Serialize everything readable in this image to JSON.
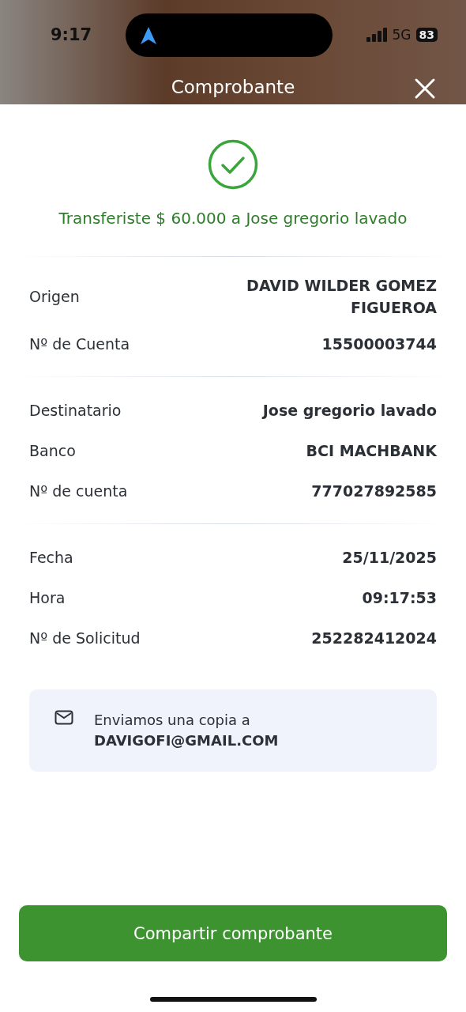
{
  "status_bar": {
    "time": "9:17",
    "network": "5G",
    "battery": "83"
  },
  "header": {
    "title": "Comprobante"
  },
  "result": {
    "message": "Transferiste $ 60.000 a Jose gregorio lavado"
  },
  "sections": [
    {
      "rows": [
        {
          "label": "Origen",
          "value": "DAVID WILDER GOMEZ FIGUEROA"
        },
        {
          "label": "Nº de Cuenta",
          "value": "15500003744"
        }
      ]
    },
    {
      "rows": [
        {
          "label": "Destinatario",
          "value": "Jose gregorio lavado"
        },
        {
          "label": "Banco",
          "value": "BCI MACHBANK"
        },
        {
          "label": "Nº de cuenta",
          "value": "777027892585"
        }
      ]
    },
    {
      "rows": [
        {
          "label": "Fecha",
          "value": "25/11/2025"
        },
        {
          "label": "Hora",
          "value": "09:17:53"
        },
        {
          "label": "Nº de Solicitud",
          "value": "252282412024"
        }
      ]
    }
  ],
  "email_notice": {
    "text": "Enviamos una copia a",
    "email": "DAVIGOFI@GMAIL.COM"
  },
  "share_button": {
    "label": "Compartir comprobante"
  }
}
